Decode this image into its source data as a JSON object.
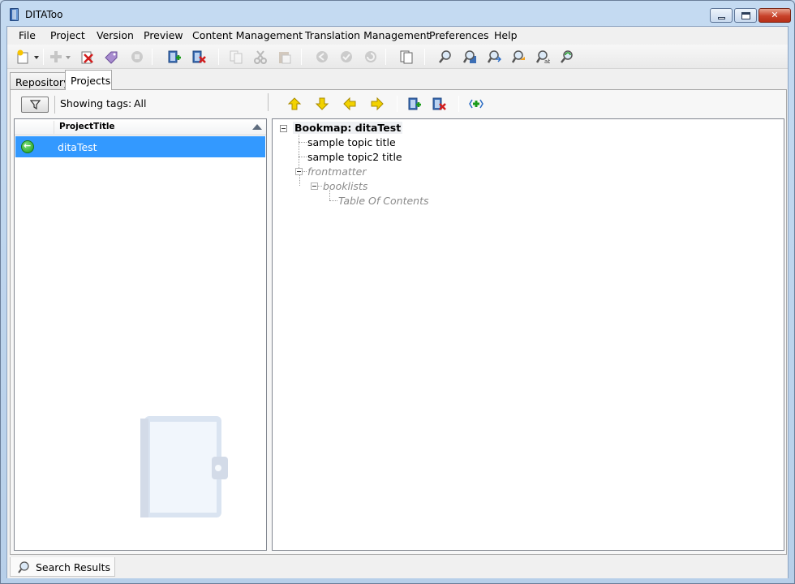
{
  "window": {
    "title": "DITATo​o",
    "title_display": "DITATo o"
  },
  "menu": [
    "File",
    "Project",
    "Version",
    "Preview",
    "Content Management",
    "Translation Management",
    "Preferences",
    "Help"
  ],
  "toolbar": {
    "icons": [
      "new-icon",
      "add-icon",
      "delete-icon",
      "tags-icon",
      "export-icon",
      "add-to-project-icon",
      "remove-from-project-icon",
      "copy-icon",
      "cut-icon",
      "paste-icon",
      "back-icon",
      "approve-icon",
      "revert-icon",
      "pages-icon",
      "search-icon",
      "search-repo-icon",
      "search-results-icon",
      "search-text-icon",
      "search-attr-icon",
      "search-refresh-icon"
    ]
  },
  "tabs": [
    "Repository",
    "Projects"
  ],
  "left_panel": {
    "showing_label": "Showing tags:",
    "showing_value": "All",
    "column_header": "ProjectTitle",
    "rows": [
      {
        "title": "ditaTest"
      }
    ]
  },
  "tree": {
    "root": "Bookmap: ditaTest",
    "children": [
      "sample topic title",
      "sample topic2 title"
    ],
    "frontmatter": "frontmatter",
    "booklists": "booklists",
    "toc": "Table Of Contents"
  },
  "bottom": {
    "tab_label": "Search Results"
  },
  "colors": {
    "selection": "#3399ff",
    "title_bar": "#c4daf1",
    "close_button": "#c8422a"
  }
}
